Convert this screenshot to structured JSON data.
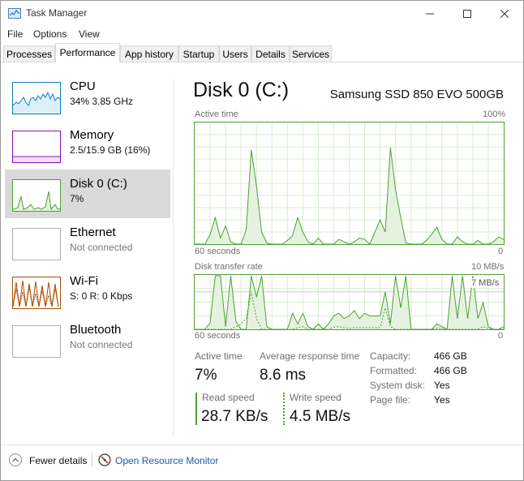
{
  "window": {
    "title": "Task Manager",
    "app_icon": "task-manager-icon"
  },
  "menu": [
    "File",
    "Options",
    "View"
  ],
  "tabs": [
    {
      "label": "Processes",
      "active": false
    },
    {
      "label": "Performance",
      "active": true
    },
    {
      "label": "App history",
      "active": false
    },
    {
      "label": "Startup",
      "active": false
    },
    {
      "label": "Users",
      "active": false
    },
    {
      "label": "Details",
      "active": false
    },
    {
      "label": "Services",
      "active": false
    }
  ],
  "sidebar": [
    {
      "title": "CPU",
      "sub": "34%  3.85 GHz",
      "color": "#117dbb",
      "selected": false
    },
    {
      "title": "Memory",
      "sub": "2.5/15.9 GB (16%)",
      "color": "#8b12ae",
      "selected": false
    },
    {
      "title": "Disk 0 (C:)",
      "sub": "7%",
      "color": "#4da033",
      "selected": true
    },
    {
      "title": "Ethernet",
      "sub": "Not connected",
      "color": "#a0a0a0",
      "selected": false
    },
    {
      "title": "Wi-Fi",
      "sub": "S: 0  R: 0 Kbps",
      "color": "#a74f01",
      "selected": false
    },
    {
      "title": "Bluetooth",
      "sub": "Not connected",
      "color": "#a0a0a0",
      "selected": false
    }
  ],
  "disk": {
    "title": "Disk 0 (C:)",
    "model": "Samsung SSD 850 EVO 500GB",
    "active_time_graph": {
      "label": "Active time",
      "max_label": "100%",
      "x_label": "60 seconds",
      "min_label": "0"
    },
    "transfer_graph": {
      "label": "Disk transfer rate",
      "max_label": "10 MB/s",
      "mid_label": "7 MB/s",
      "x_label": "60 seconds",
      "min_label": "0"
    },
    "stats": {
      "active_time_label": "Active time",
      "active_time_value": "7%",
      "avg_response_label": "Average response time",
      "avg_response_value": "8.6 ms",
      "read_speed_label": "Read speed",
      "read_speed_value": "28.7 KB/s",
      "write_speed_label": "Write speed",
      "write_speed_value": "4.5 MB/s"
    },
    "properties": [
      {
        "label": "Capacity:",
        "value": "466 GB"
      },
      {
        "label": "Formatted:",
        "value": "466 GB"
      },
      {
        "label": "System disk:",
        "value": "Yes"
      },
      {
        "label": "Page file:",
        "value": "Yes"
      }
    ],
    "accent_color": "#4da033",
    "fill_color": "#e6f2e0"
  },
  "footer": {
    "fewer_details": "Fewer details",
    "resource_monitor": "Open Resource Monitor"
  },
  "chart_data": [
    {
      "type": "area",
      "title": "Active time",
      "xlabel": "60 seconds",
      "ylabel": "",
      "ylim": [
        0,
        100
      ],
      "x": [
        60,
        58,
        57,
        56,
        55,
        54,
        53,
        52,
        51,
        50,
        49,
        48,
        47,
        46,
        45,
        44,
        43,
        42,
        41,
        40,
        39,
        38,
        37,
        36,
        35,
        34,
        33,
        32,
        31,
        30,
        29,
        28,
        27,
        26,
        25,
        24,
        23,
        22,
        21,
        20,
        19,
        18,
        17,
        16,
        15,
        14,
        13,
        12,
        11,
        10,
        9,
        8,
        7,
        6,
        5,
        4,
        3,
        2,
        1,
        0
      ],
      "values": [
        0,
        0,
        8,
        22,
        5,
        15,
        2,
        0,
        0,
        12,
        78,
        48,
        10,
        1,
        0,
        0,
        0,
        3,
        7,
        22,
        10,
        2,
        0,
        5,
        0,
        0,
        0,
        4,
        2,
        0,
        2,
        5,
        4,
        0,
        10,
        20,
        10,
        80,
        45,
        22,
        1,
        0,
        0,
        0,
        3,
        8,
        14,
        4,
        0,
        0,
        6,
        2,
        0,
        0,
        3,
        0,
        0,
        2,
        6,
        4
      ],
      "grid": true
    },
    {
      "type": "line",
      "title": "Disk transfer rate",
      "xlabel": "60 seconds",
      "ylabel": "",
      "ylim": [
        0,
        10
      ],
      "y_label_value": 7,
      "x": [
        60,
        58,
        57,
        56,
        55,
        54,
        53,
        52,
        51,
        50,
        49,
        48,
        47,
        46,
        45,
        44,
        43,
        42,
        41,
        40,
        39,
        38,
        37,
        36,
        35,
        34,
        33,
        32,
        31,
        30,
        29,
        28,
        27,
        26,
        25,
        24,
        23,
        22,
        21,
        20,
        19,
        18,
        17,
        16,
        15,
        14,
        13,
        12,
        11,
        10,
        9,
        8,
        7,
        6,
        5,
        4,
        3,
        2,
        1,
        0
      ],
      "series": [
        {
          "values": [
            0,
            0,
            1.2,
            10,
            10,
            0.5,
            10,
            1.5,
            0,
            0,
            10,
            6,
            10,
            0.5,
            0,
            0,
            0,
            0,
            3,
            1,
            3,
            0.5,
            0,
            1,
            0,
            1,
            2.5,
            3,
            2,
            2.5,
            3.5,
            2,
            3,
            2.5,
            2.5,
            2.5,
            7,
            1,
            10,
            4,
            10,
            0,
            0,
            0,
            0,
            0,
            1,
            0.5,
            0,
            10,
            2,
            10,
            2,
            10,
            2,
            5,
            0.5,
            0,
            0,
            0.5
          ]
        },
        {
          "values": [
            0,
            0,
            0,
            0,
            0,
            0,
            0,
            0.5,
            1,
            2,
            7,
            2,
            0,
            0,
            0,
            0,
            0,
            0,
            0,
            0.3,
            0.5,
            0,
            0,
            0,
            0,
            0,
            0.4,
            0.5,
            0.3,
            0.2,
            0.3,
            0.3,
            0.3,
            0.3,
            0.3,
            0.3,
            4,
            0.5,
            0,
            0,
            0,
            0,
            0,
            0,
            0,
            0,
            0.2,
            0.2,
            0,
            0,
            0,
            0,
            0,
            0,
            0,
            0.5,
            0.2,
            0,
            0,
            0
          ]
        }
      ],
      "grid": true
    }
  ]
}
